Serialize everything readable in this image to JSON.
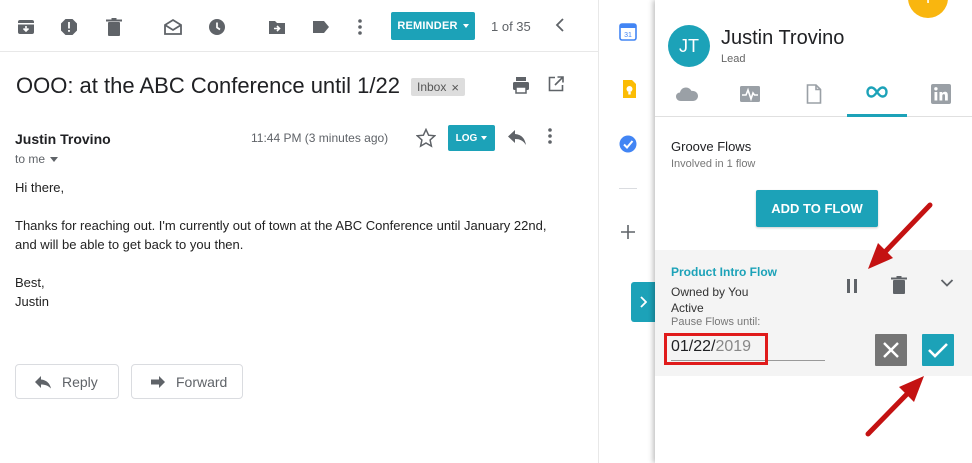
{
  "toolbar": {
    "icons": [
      "archive-icon",
      "report-spam-icon",
      "delete-icon",
      "mark-unread-icon",
      "snooze-icon",
      "move-to-icon",
      "label-icon",
      "more-vert-icon"
    ],
    "reminder_label": "REMINDER",
    "pager_text": "1 of 35"
  },
  "email": {
    "subject": "OOO: at the ABC Conference until 1/22",
    "label_chip": "Inbox",
    "sender": "Justin Trovino",
    "to": "to me",
    "time": "11:44 PM (3 minutes ago)",
    "log_label": "LOG",
    "body": {
      "greeting": "Hi there,",
      "line1": "Thanks for reaching out. I'm currently out of town at the ABC Conference until January 22nd,",
      "line2": "and will be able to get back to you then.",
      "signoff": "Best,",
      "signature": "Justin"
    },
    "reply_label": "Reply",
    "forward_label": "Forward"
  },
  "sidestrip": {
    "icons": [
      "calendar-icon",
      "keep-icon",
      "tasks-icon",
      "add-icon"
    ]
  },
  "panel": {
    "avatar_initials": "JT",
    "contact_name": "Justin Trovino",
    "contact_role": "Lead",
    "tabs": [
      "salesforce-cloud-icon",
      "activity-icon",
      "document-icon",
      "flows-infinity-icon",
      "linkedin-icon"
    ],
    "section_title": "Groove Flows",
    "section_sub": "Involved in 1 flow",
    "add_label": "ADD TO FLOW",
    "flow": {
      "name": "Product Intro Flow",
      "owner": "Owned by You",
      "status": "Active",
      "pause_label": "Pause Flows until:",
      "date_typed": "01/22/",
      "date_hint": "2019"
    }
  },
  "colors": {
    "accent": "#1ca2b8",
    "annotation": "#e01b1b",
    "fab": "#f9b60f"
  }
}
